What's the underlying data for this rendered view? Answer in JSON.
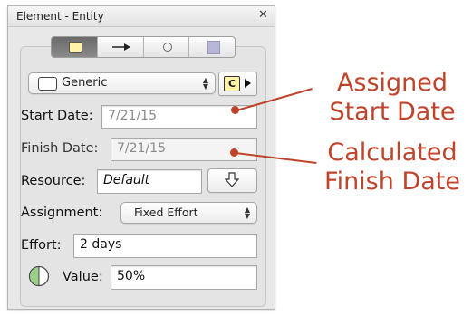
{
  "window": {
    "title": "Element - Entity"
  },
  "type_popup": {
    "value": "Generic"
  },
  "fields": {
    "start_date": {
      "label": "Start Date:",
      "value": "7/21/15"
    },
    "finish_date": {
      "label": "Finish Date:",
      "value": "7/21/15"
    },
    "resource": {
      "label": "Resource:",
      "value": "Default"
    },
    "assignment": {
      "label": "Assignment:",
      "value": "Fixed Effort"
    },
    "effort": {
      "label": "Effort:",
      "value": "2 days"
    },
    "value": {
      "label": "Value:",
      "value": "50%"
    }
  },
  "style_button": {
    "glyph": "C"
  },
  "annotations": {
    "assigned": "Assigned Start Date",
    "calculated": "Calculated Finish Date"
  },
  "icons": [
    "close-icon",
    "node-tab-icon",
    "arrow-tab-icon",
    "circle-tab-icon",
    "shape-tab-icon",
    "style-c-icon",
    "triangle-right-icon",
    "down-arrow-icon",
    "pie-value-icon"
  ],
  "colors": {
    "annotation": "#c0442b",
    "tab_active": "#7a7a7a",
    "node_yellow": "#fff3a6"
  }
}
